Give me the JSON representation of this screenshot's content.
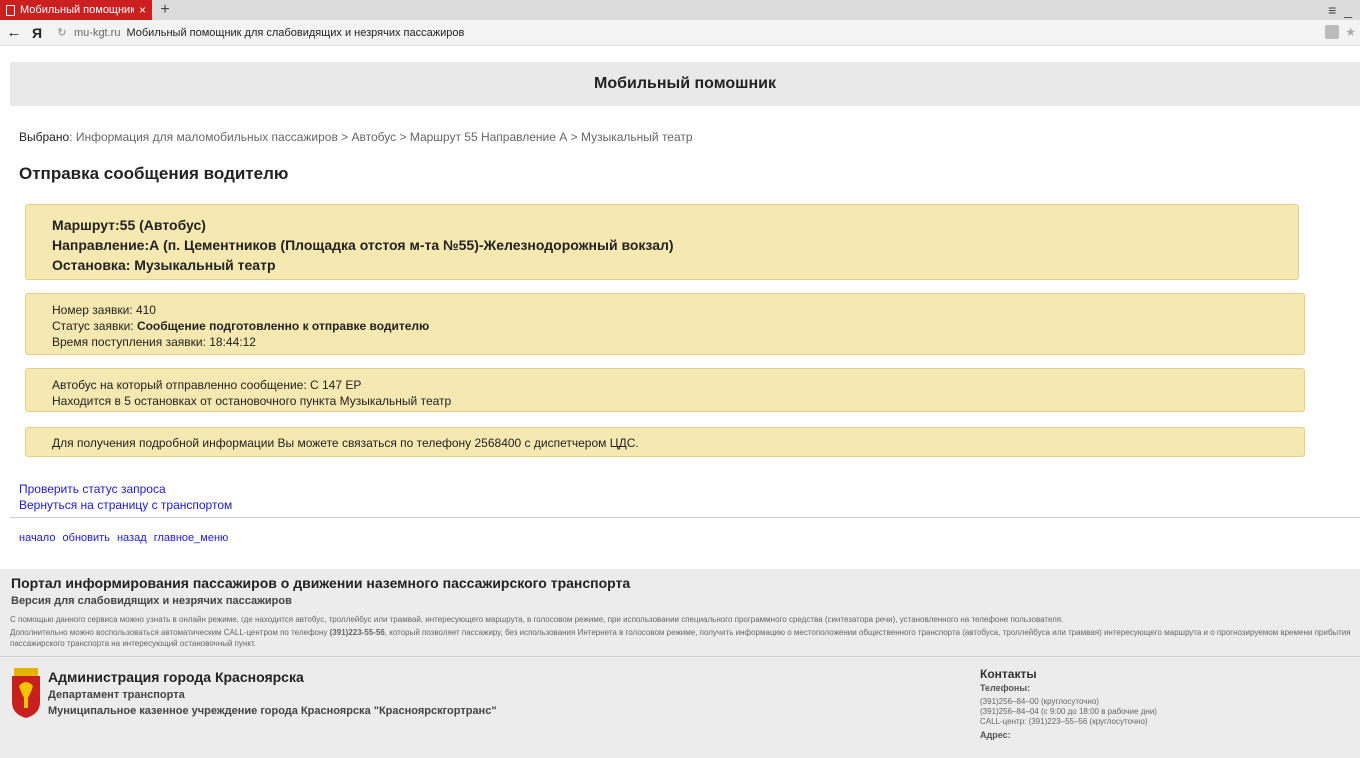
{
  "browser": {
    "tab_title": "Мобильный помощник",
    "tab_close": "×",
    "new_tab": "+",
    "menu": "≡ _",
    "back": "←",
    "yandex": "Я",
    "reload": "↻",
    "domain": "mu-kgt.ru",
    "page_title": "Мобильный помощник для слабовидящих и незрячих пассажиров",
    "star": "★"
  },
  "header": {
    "title": "Мобильный помошник"
  },
  "breadcrumb": {
    "label": "Выбрано",
    "path": ": Информация для маломобильных пассажиров > Автобус > Маршрут 55 Направление А > Музыкальный театр"
  },
  "heading": "Отправка сообщения водителю",
  "route_card": {
    "route": "Маршрут:55 (Автобус)",
    "direction": "Направление:А (п. Цементников (Площадка отстоя м-та №55)-Железнодорожный вокзал)",
    "stop": "Остановка: Музыкальный театр"
  },
  "request_card": {
    "number": "Номер заявки: 410",
    "status_label": "Статус заявки: ",
    "status_value": "Сообщение подготовленно к отправке водителю",
    "time": "Время поступления заявки: 18:44:12"
  },
  "bus_card": {
    "bus": "Автобус на который отправленно сообщение: С 147 ЕР",
    "distance": "Находится в 5 остановках от остановочного пункта Музыкальный театр"
  },
  "info_card": {
    "text": "Для получения подробной информации Вы можете связаться по телефону 2568400 с диспетчером ЦДС."
  },
  "links": {
    "check_status": "Проверить статус запроса",
    "back_to_transport": "Вернуться на страницу с транспортом"
  },
  "nav": {
    "start": "начало",
    "refresh": "обновить",
    "back": "назад",
    "main_menu": "главное_меню"
  },
  "footer": {
    "portal_title": "Портал информирования пассажиров о движении наземного пассажирского транспорта",
    "portal_sub": "Версия для слабовидящих и незрячих пассажиров",
    "p1": "С помощью данного сервиса можно узнать в онлайн режиме, где находится автобус, троллейбус или трамвай, интересующего маршрута, в голосовом режиме, при использовании специального программного средства (синтезатора речи), установленного на телефоне пользователя.",
    "p2_a": "Дополнительно можно воспользоваться автоматическим CALL-центром по телефону ",
    "p2_phone": "(391)223-55-56",
    "p2_b": ", который позволяет пассажиру, без использования Интернета в голосовом режиме, получить информацию о местоположении общественного транспорта (автобуса, троллейбуса или трамвая) интересующего маршрута и о прогнозируемом времени прибытия пассажирского транспорта на интересующий остановочный пункт.",
    "admin_title": "Администрация города Красноярска",
    "admin_dept": "Департамент транспорта",
    "admin_org": "Муниципальное казенное учреждение города Красноярска \"Красноярскгортранс\"",
    "contacts_title": "Контакты",
    "phones_label": "Телефоны:",
    "phone1": "(391)256–84–00 (круглосуточно)",
    "phone2": "(391)256–84–04 (с 9:00 до 18:00 в рабочие дни)",
    "phone3": "CALL-центр: (391)223–55–56 (круглосуточно)",
    "address_label": "Адрес:"
  },
  "colors": {
    "tab_red": "#cc1f1f",
    "card_bg": "#f6e8b1",
    "link_blue": "#1a1ad6"
  }
}
